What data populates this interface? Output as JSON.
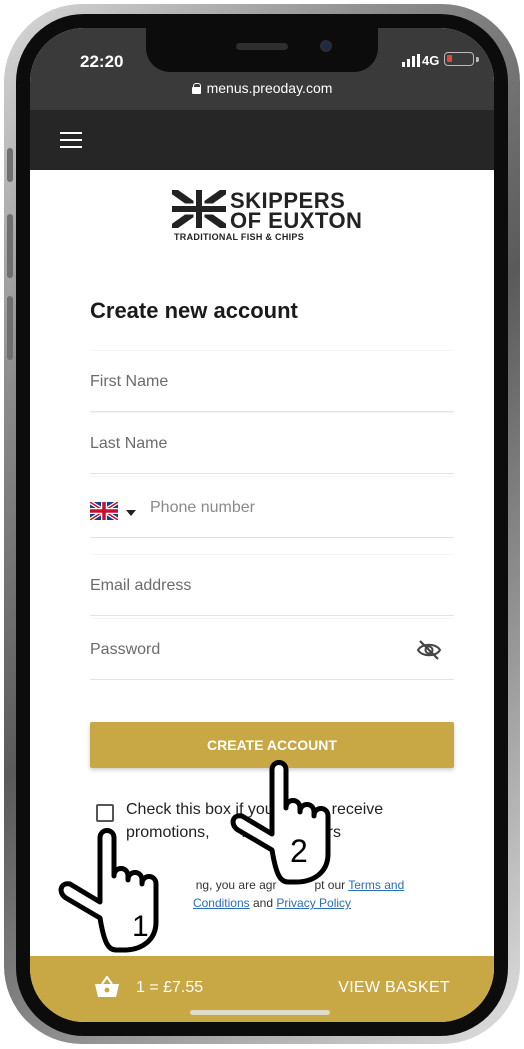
{
  "status_bar": {
    "time": "22:20",
    "network": "4G",
    "url": "menus.preoday.com"
  },
  "brand": {
    "name_line1": "SKIPPERS",
    "name_line2": "OF EUXTON",
    "tagline": "TRADITIONAL FISH & CHIPS"
  },
  "form": {
    "title": "Create new account",
    "first_name_placeholder": "First Name",
    "last_name_placeholder": "Last Name",
    "phone_placeholder": "Phone number",
    "email_placeholder": "Email address",
    "password_placeholder": "Password",
    "submit_label": "CREATE ACCOUNT",
    "newsletter_label_line1": "Check this box if you",
    "newsletter_label_line1_end": "receive",
    "newsletter_label_line2": "promotions,",
    "newsletter_label_line2_mid": "rs",
    "newsletter_label_line2_end": "etters",
    "agree_prefix": "ng, you are agr",
    "agree_mid": "pt our",
    "terms_link": "Terms and",
    "conditions_link": "Conditions",
    "agree_and": "and",
    "privacy_link": "Privacy Policy"
  },
  "basket": {
    "summary": "1 = £7.55",
    "view_label": "VIEW BASKET"
  },
  "annotations": {
    "step1": "1",
    "step2": "2"
  },
  "colors": {
    "accent": "#c8a845",
    "navbar": "#262626",
    "link": "#2b6db5"
  }
}
